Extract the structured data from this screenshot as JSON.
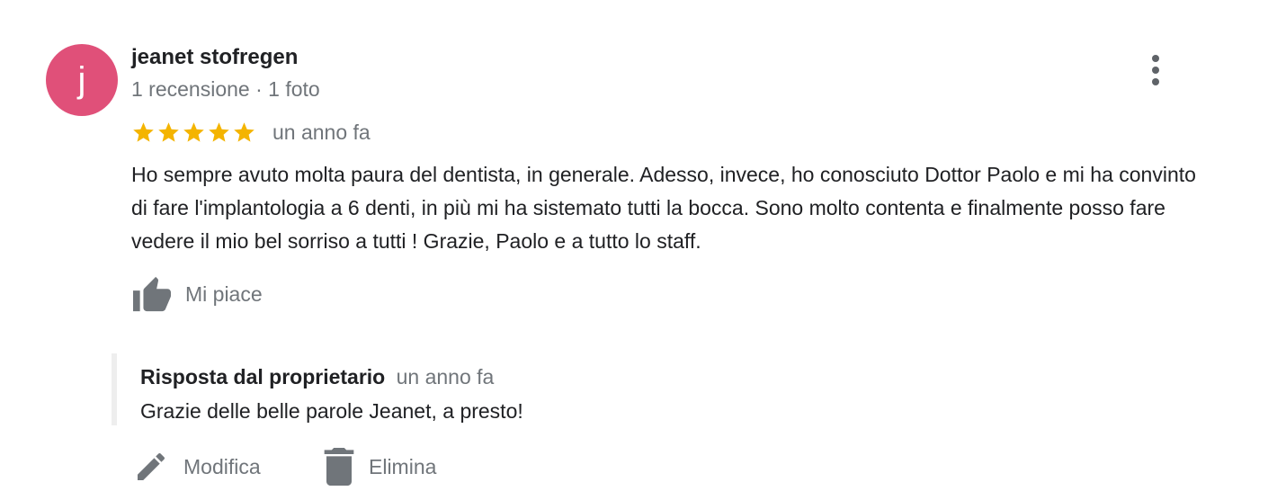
{
  "review": {
    "avatar_letter": "j",
    "avatar_color": "#e05079",
    "author": "jeanet stofregen",
    "meta": "1 recensione · 1 foto",
    "rating": 5,
    "rating_max": 5,
    "star_color": "#f4b400",
    "date": "un anno fa",
    "text": "Ho sempre avuto molta paura del dentista, in generale. Adesso, invece, ho conosciuto Dottor Paolo e mi ha convinto di fare l'implantologia a 6 denti, in più mi ha sistemato tutti la bocca. Sono molto contenta e finalmente posso fare vedere il mio bel sorriso a tutti ! Grazie, Paolo e a tutto lo staff.",
    "like_label": "Mi piace",
    "like_icon": "thumb-up-icon",
    "menu_icon": "more-vert-icon"
  },
  "reply": {
    "title": "Risposta dal proprietario",
    "date": "un anno fa",
    "text": "Grazie delle belle parole Jeanet, a presto!"
  },
  "actions": {
    "edit_label": "Modifica",
    "edit_icon": "pencil-icon",
    "delete_label": "Elimina",
    "delete_icon": "trash-icon"
  }
}
